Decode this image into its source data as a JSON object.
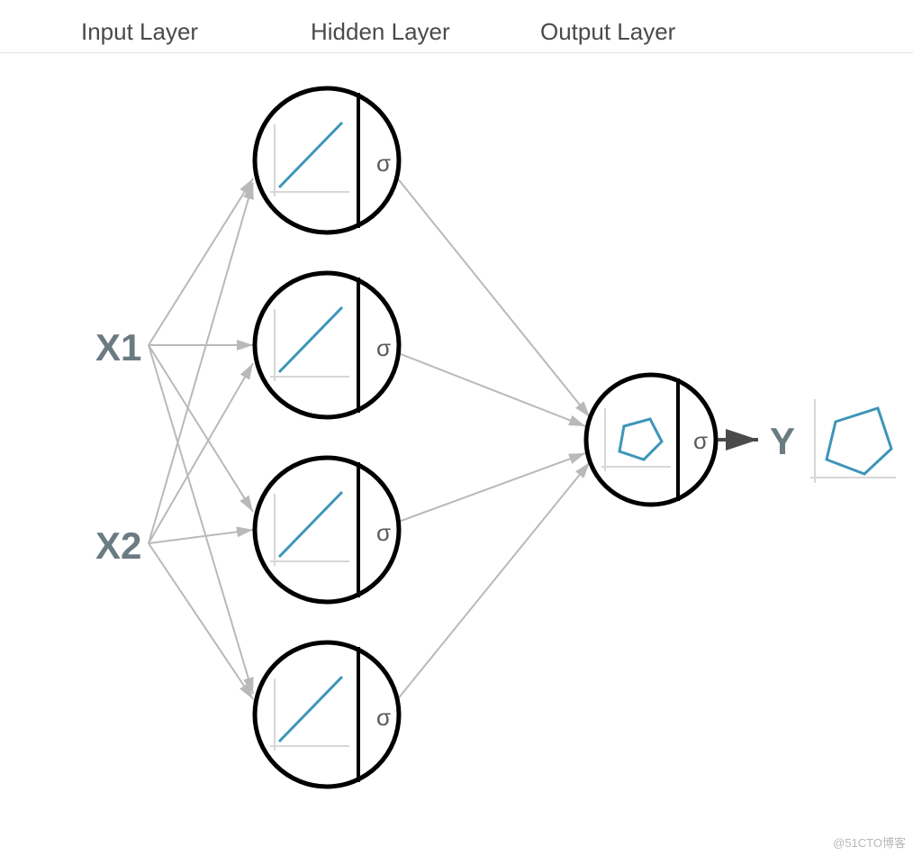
{
  "header": {
    "input": "Input Layer",
    "hidden": "Hidden Layer",
    "output": "Output Layer"
  },
  "inputs": {
    "x1": "X1",
    "x2": "X2"
  },
  "output": {
    "y": "Y"
  },
  "sigma": "σ",
  "watermark": "@51CTO博客",
  "colors": {
    "headerText": "#4a4a4a",
    "labelText": "#6b7b82",
    "nodeStroke": "#000000",
    "edge": "#b9b9b9",
    "axis": "#d7d7d7",
    "accent": "#3d95b8",
    "outputArrow": "#4a4a4a"
  },
  "structure": {
    "input_nodes": 2,
    "hidden_nodes": 4,
    "output_nodes": 1,
    "activation": "sigma"
  }
}
